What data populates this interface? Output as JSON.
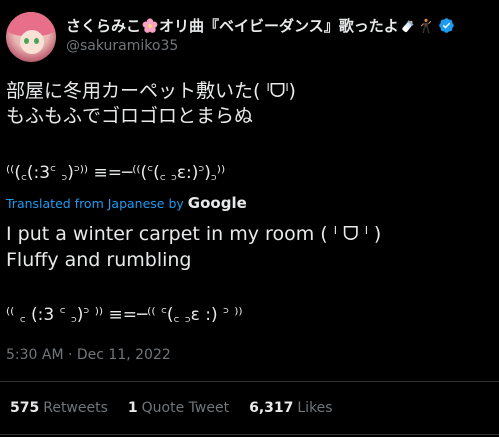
{
  "author": {
    "display_name_part1": "さくらみこ",
    "display_name_part2": "オリ曲『ベイビーダンス』歌ったよ",
    "handle": "@sakuramiko35",
    "verified": true
  },
  "tweet": {
    "text": "部屋に冬用カーペット敷いた( ˡᗜˡ)\nもふもふでゴロゴロとまらぬ",
    "kaomoji": "⁽⁽(꜀(:3꜂ ꜆)꜄⁾⁾ ≡=─⁽⁽(꜂(꜀ ꜆ε:)꜄)꜆⁾⁾",
    "translated_label": "Translated from Japanese by",
    "translated_provider": "Google",
    "translation_text": "I put a winter carpet in my room ( ˡ ᗜ ˡ )\nFluffy and rumbling",
    "translation_kaomoji": "⁽⁽ ꜀ (:3 ꜂ ꜆)꜄ ⁾⁾ ≡=─⁽⁽ ꜂(꜀ ꜆ε :) ꜄ ⁾⁾",
    "timestamp": "5:30 AM · Dec 11, 2022"
  },
  "stats": {
    "retweets_count": "575",
    "retweets_label": "Retweets",
    "quotes_count": "1",
    "quotes_label": "Quote Tweet",
    "likes_count": "6,317",
    "likes_label": "Likes"
  },
  "colors": {
    "background": "#000000",
    "text_primary": "#e7e9ea",
    "text_secondary": "#71767b",
    "link": "#1d9bf0",
    "divider": "#2f3336"
  },
  "icons": {
    "flower": "cherry-blossom-icon",
    "bottle": "baby-bottle-icon",
    "person": "dancer-icon",
    "verified": "verified-badge-icon"
  }
}
